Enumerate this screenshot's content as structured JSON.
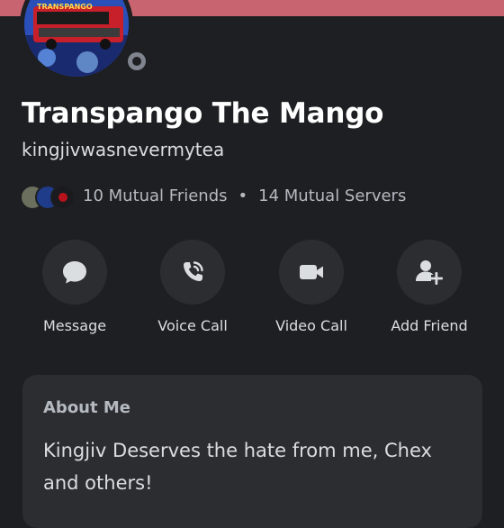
{
  "profile": {
    "display_name": "Transpango The Mango",
    "username": "kingjivwasnevermytea",
    "avatar_text": "TRANSPANGO",
    "banner_color": "#c8646f",
    "status": "offline"
  },
  "mutuals": {
    "friends": "10 Mutual Friends",
    "separator": "•",
    "servers": "14 Mutual Servers"
  },
  "actions": [
    {
      "label": "Message",
      "icon": "chat-bubble-icon"
    },
    {
      "label": "Voice Call",
      "icon": "phone-icon"
    },
    {
      "label": "Video Call",
      "icon": "video-camera-icon"
    },
    {
      "label": "Add Friend",
      "icon": "add-friend-icon"
    }
  ],
  "about": {
    "title": "About Me",
    "text": "Kingjiv Deserves the hate from me, Chex and others!"
  }
}
